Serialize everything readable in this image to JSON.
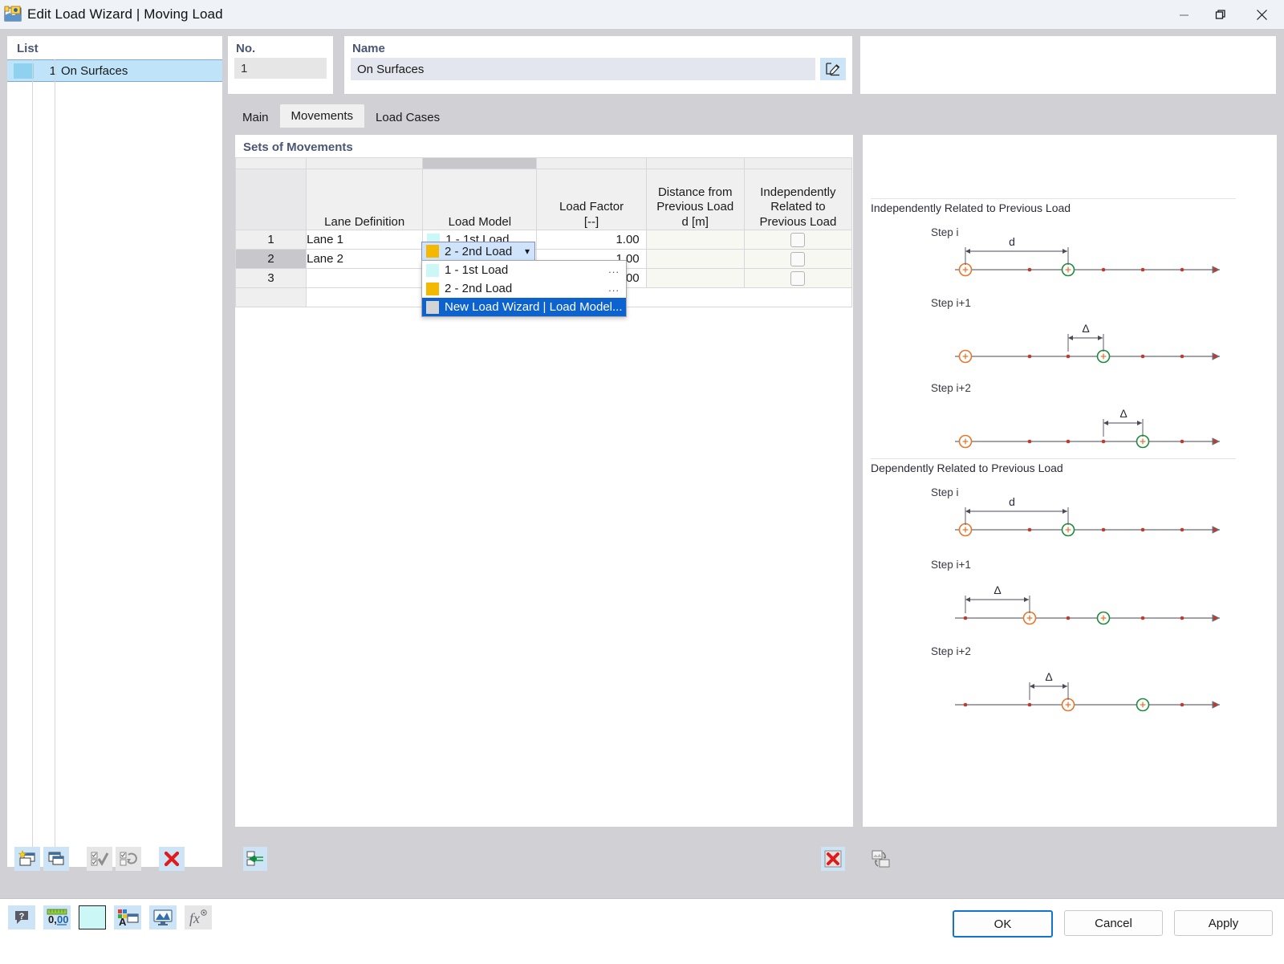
{
  "window": {
    "title": "Edit Load Wizard | Moving Load",
    "app_icon": "load-wizard-icon",
    "minimize": "—",
    "restore": "❐",
    "close": "✕"
  },
  "list_panel": {
    "label": "List",
    "rows": [
      {
        "index": "1",
        "name": "On Surfaces",
        "color": "#8ed2ef",
        "selected": true
      }
    ],
    "toolbar": [
      {
        "name": "new-item-button",
        "icon": "new-window-star-icon",
        "enabled": true
      },
      {
        "name": "copy-item-button",
        "icon": "copy-windows-icon",
        "enabled": true
      },
      {
        "name": "select-all-button",
        "icon": "check-all-icon",
        "enabled": false
      },
      {
        "name": "invert-selection-button",
        "icon": "invert-selection-icon",
        "enabled": false
      },
      {
        "name": "delete-item-button",
        "icon": "red-x-icon",
        "enabled": true
      }
    ]
  },
  "no_panel": {
    "label": "No.",
    "value": "1"
  },
  "name_panel": {
    "label": "Name",
    "value": "On Surfaces",
    "edit_icon": "edit-pencil-icon"
  },
  "tabs": [
    {
      "label": "Main",
      "active": false
    },
    {
      "label": "Movements",
      "active": true
    },
    {
      "label": "Load Cases",
      "active": false
    }
  ],
  "sets_panel": {
    "title": "Sets of Movements",
    "columns": [
      {
        "header": "",
        "key": "rownum"
      },
      {
        "header": "Lane Definition",
        "key": "lane"
      },
      {
        "header": "Load Model",
        "key": "model"
      },
      {
        "header": "Load Factor\n[--]",
        "header_lines": [
          "Load Factor",
          "[--]"
        ],
        "key": "factor"
      },
      {
        "header_lines": [
          "Distance from",
          "Previous Load",
          "d [m]"
        ],
        "key": "distance"
      },
      {
        "header_lines": [
          "Independently",
          "Related to",
          "Previous Load"
        ],
        "key": "independently"
      }
    ],
    "rows": [
      {
        "rownum": "1",
        "lane": "Lane 1",
        "model": "1 - 1st Load",
        "model_color": "#ccf7f7",
        "factor": "1.00",
        "distance": "",
        "independently": false,
        "selected": false
      },
      {
        "rownum": "2",
        "lane": "Lane 2",
        "model": "2 - 2nd Load",
        "model_color": "#f5b800",
        "factor": "1.00",
        "distance": "",
        "independently": false,
        "selected": true
      },
      {
        "rownum": "3",
        "lane": "",
        "model": "",
        "model_color": "",
        "factor": "0.00",
        "distance": "",
        "independently": false,
        "selected": false
      }
    ],
    "dropdown": {
      "open": true,
      "current": {
        "label": "2 - 2nd Load",
        "color": "#f5b800"
      },
      "options": [
        {
          "label": "1 - 1st Load",
          "color": "#ccf7f7",
          "ellipsis": "...",
          "selected": false
        },
        {
          "label": "2 - 2nd Load",
          "color": "#f5b800",
          "ellipsis": "...",
          "selected": false
        },
        {
          "label": "New Load Wizard | Load Model...",
          "color": "#d4d4d4",
          "ellipsis": "",
          "selected": true
        }
      ]
    },
    "bottom_toolbar": [
      {
        "name": "import-row-button",
        "icon": "insert-row-arrow-icon"
      },
      {
        "name": "delete-row-button",
        "icon": "red-x-icon"
      }
    ]
  },
  "diagram_panel": {
    "sections": [
      {
        "title": "Independently Related to Previous Load",
        "steps": [
          {
            "label": "Step i",
            "dim_label": "d",
            "dim_from": 1,
            "dim_to": 4,
            "orange_at": 1,
            "green_at": 4
          },
          {
            "label": "Step i+1",
            "dim_label": "Δ",
            "dim_from": 4,
            "dim_to": 6,
            "orange_at": 1,
            "green_at": 6
          },
          {
            "label": "Step i+2",
            "dim_label": "Δ",
            "dim_from": 6,
            "dim_to": 8,
            "orange_at": 1,
            "green_at": 8
          }
        ]
      },
      {
        "title": "Dependently Related to Previous Load",
        "steps": [
          {
            "label": "Step i",
            "dim_label": "d",
            "dim_from": 1,
            "dim_to": 4,
            "orange_at": 1,
            "green_at": 4
          },
          {
            "label": "Step i+1",
            "dim_label": "Δ",
            "dim_from": 1,
            "dim_to": 3,
            "orange_at": 3,
            "green_at": 6
          },
          {
            "label": "Step i+2",
            "dim_label": "Δ",
            "dim_from": 3,
            "dim_to": 5,
            "orange_at": 5,
            "green_at": 8
          }
        ]
      }
    ],
    "bottom_button": {
      "name": "export-image-button",
      "icon": "save-image-icon"
    },
    "colors": {
      "orange": "#e8762c",
      "green": "#1e8a3c",
      "dot": "#c0392b",
      "axis": "#6b6b78",
      "text": "#3a3a46"
    }
  },
  "bottom_bar": {
    "tools": [
      {
        "name": "help-button",
        "icon": "help-bubble-icon",
        "style": "blue"
      },
      {
        "name": "units-button",
        "icon": "ruler-000-icon",
        "style": "blue"
      },
      {
        "name": "color-swatch-button",
        "icon": "color-swatch",
        "style": "swatch",
        "color": "#ccf7f7"
      },
      {
        "name": "display-properties-button",
        "icon": "color-letter-icon",
        "style": "blue"
      },
      {
        "name": "view-settings-button",
        "icon": "monitor-icon",
        "style": "blue"
      },
      {
        "name": "formula-button",
        "icon": "fx-icon",
        "style": "gray"
      }
    ],
    "buttons": [
      {
        "label": "OK",
        "primary": true,
        "name": "ok-button"
      },
      {
        "label": "Cancel",
        "primary": false,
        "name": "cancel-button"
      },
      {
        "label": "Apply",
        "primary": false,
        "name": "apply-button"
      }
    ]
  }
}
